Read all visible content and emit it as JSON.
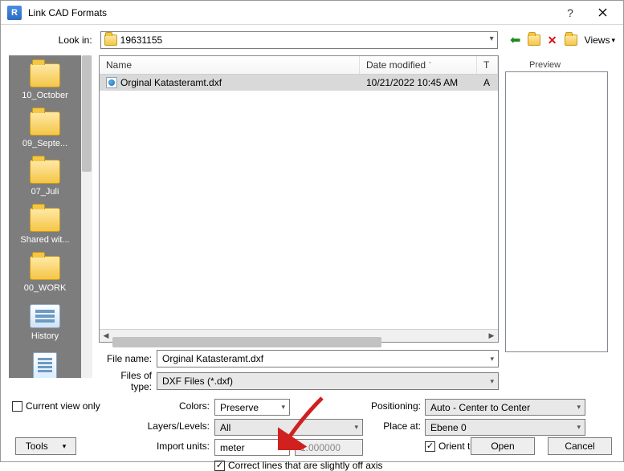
{
  "window": {
    "title": "Link CAD Formats",
    "app_letter": "R"
  },
  "lookin": {
    "label": "Look in:",
    "value": "19631155"
  },
  "toolbar": {
    "views_label": "Views"
  },
  "preview": {
    "label": "Preview"
  },
  "places": [
    {
      "label": "10_October",
      "icon": "folder"
    },
    {
      "label": "09_Septe...",
      "icon": "folder"
    },
    {
      "label": "07_Juli",
      "icon": "folder"
    },
    {
      "label": "Shared wit...",
      "icon": "folder"
    },
    {
      "label": "00_WORK",
      "icon": "folder"
    },
    {
      "label": "History",
      "icon": "history"
    },
    {
      "label": "",
      "icon": "journal"
    }
  ],
  "filelist": {
    "columns": {
      "name": "Name",
      "date": "Date modified",
      "type": "T"
    },
    "rows": [
      {
        "name": "Orginal Katasteramt.dxf",
        "date": "10/21/2022 10:45 AM",
        "type": "A",
        "selected": true
      }
    ]
  },
  "filename": {
    "label": "File name:",
    "value": "Orginal Katasteramt.dxf"
  },
  "filetype": {
    "label": "Files of type:",
    "value": "DXF Files  (*.dxf)"
  },
  "options": {
    "current_view_only": {
      "label": "Current view only",
      "checked": false
    },
    "colors": {
      "label": "Colors:",
      "value": "Preserve"
    },
    "layers": {
      "label": "Layers/Levels:",
      "value": "All"
    },
    "import_units": {
      "label": "Import units:",
      "value": "meter",
      "scale": "1.000000"
    },
    "correct_off_axis": {
      "label": "Correct lines that are slightly off axis",
      "checked": true
    },
    "positioning": {
      "label": "Positioning:",
      "value": "Auto - Center to Center"
    },
    "place_at": {
      "label": "Place at:",
      "value": "Ebene 0"
    },
    "orient_to_view": {
      "label": "Orient to View",
      "checked": true
    }
  },
  "buttons": {
    "tools": "Tools",
    "open": "Open",
    "cancel": "Cancel"
  }
}
